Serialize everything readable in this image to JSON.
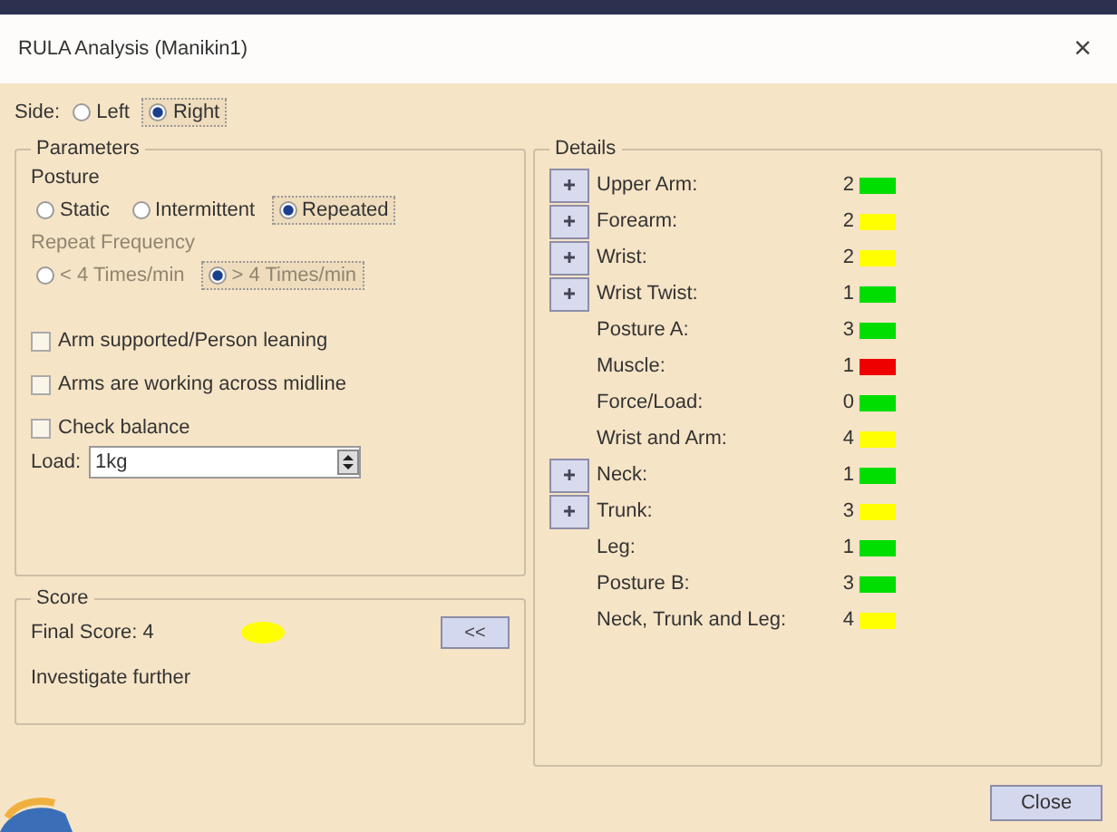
{
  "window": {
    "title": "RULA Analysis (Manikin1)",
    "close": "×"
  },
  "side": {
    "label": "Side:",
    "options": [
      {
        "label": "Left",
        "selected": false
      },
      {
        "label": "Right",
        "selected": true
      }
    ]
  },
  "parameters": {
    "title": "Parameters",
    "posture_label": "Posture",
    "posture": [
      {
        "label": "Static",
        "selected": false
      },
      {
        "label": "Intermittent",
        "selected": false
      },
      {
        "label": "Repeated",
        "selected": true
      }
    ],
    "frequency_label": "Repeat Frequency",
    "frequency_disabled": true,
    "frequency": [
      {
        "label": "< 4 Times/min",
        "selected": false
      },
      {
        "label": "> 4 Times/min",
        "selected": true
      }
    ],
    "checks": [
      {
        "label": "Arm supported/Person leaning",
        "checked": false
      },
      {
        "label": "Arms are working across midline",
        "checked": false
      },
      {
        "label": "Check balance",
        "checked": false
      }
    ],
    "load": {
      "label": "Load:",
      "value": "1kg"
    }
  },
  "score": {
    "title": "Score",
    "final": "Final Score: 4",
    "color": "#ffff00",
    "advice": "Investigate further",
    "collapse_button": "<<"
  },
  "details": {
    "title": "Details",
    "rows": [
      {
        "label": "Upper Arm:",
        "value": "2",
        "color": "#00dd00",
        "expandable": true
      },
      {
        "label": "Forearm:",
        "value": "2",
        "color": "#ffff00",
        "expandable": true
      },
      {
        "label": "Wrist:",
        "value": "2",
        "color": "#ffff00",
        "expandable": true
      },
      {
        "label": "Wrist Twist:",
        "value": "1",
        "color": "#00dd00",
        "expandable": true
      },
      {
        "label": "Posture A:",
        "value": "3",
        "color": "#00dd00",
        "expandable": false
      },
      {
        "label": "Muscle:",
        "value": "1",
        "color": "#ee0000",
        "expandable": false
      },
      {
        "label": "Force/Load:",
        "value": "0",
        "color": "#00dd00",
        "expandable": false
      },
      {
        "label": "Wrist and Arm:",
        "value": "4",
        "color": "#ffff00",
        "expandable": false
      },
      {
        "label": "Neck:",
        "value": "1",
        "color": "#00dd00",
        "expandable": true
      },
      {
        "label": "Trunk:",
        "value": "3",
        "color": "#ffff00",
        "expandable": true
      },
      {
        "label": "Leg:",
        "value": "1",
        "color": "#00dd00",
        "expandable": false
      },
      {
        "label": "Posture B:",
        "value": "3",
        "color": "#00dd00",
        "expandable": false
      },
      {
        "label": "Neck, Trunk and Leg:",
        "value": "4",
        "color": "#ffff00",
        "expandable": false
      }
    ]
  },
  "close_button": "Close"
}
